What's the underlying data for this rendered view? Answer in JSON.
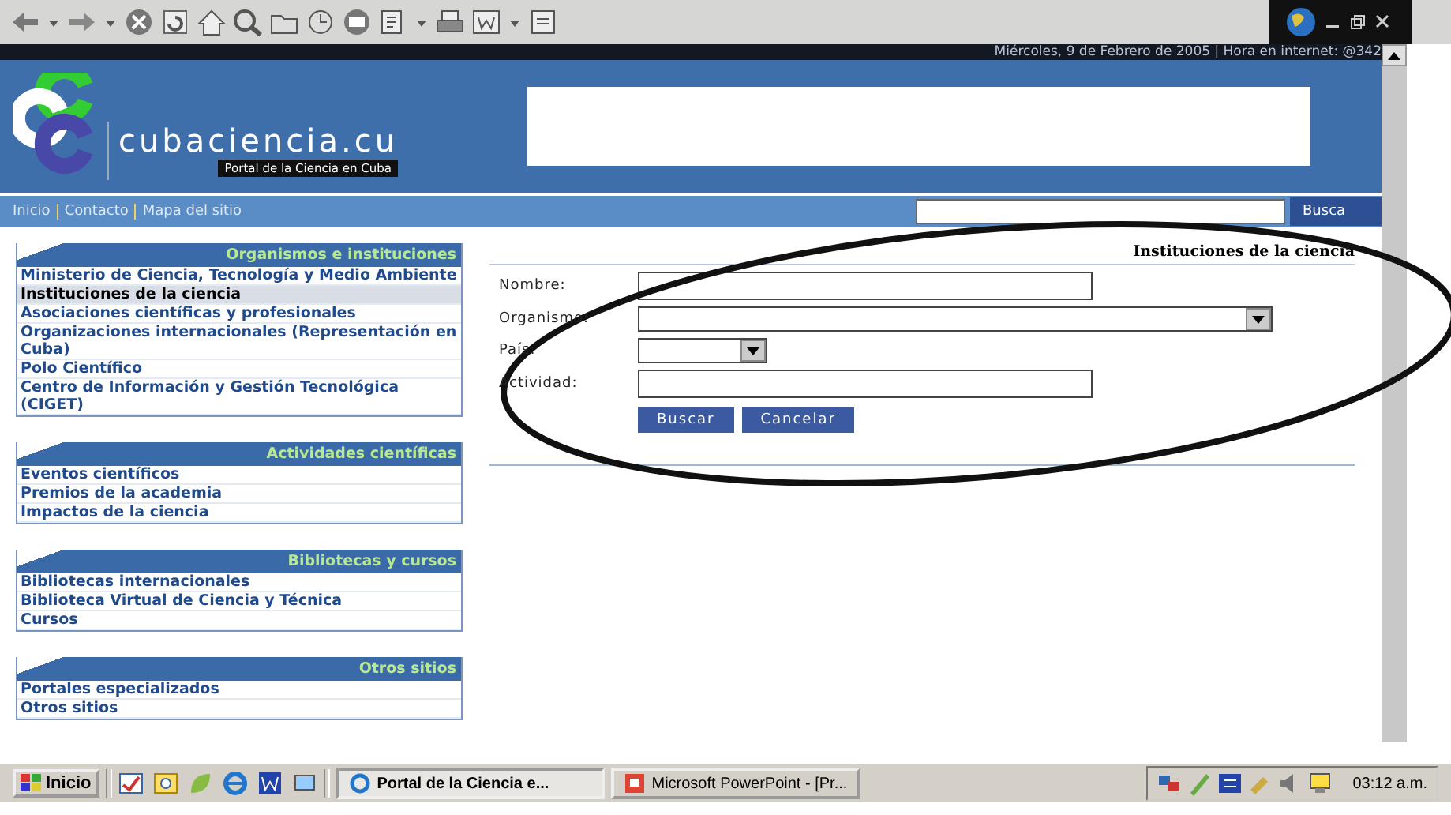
{
  "header": {
    "date_line": "Miércoles, 9 de Febrero de 2005 | Hora en internet: @342",
    "logo_text": "cubaciencia.cu",
    "logo_tagline": "Portal de la Ciencia en Cuba"
  },
  "nav": {
    "links": [
      "Inicio",
      "Contacto",
      "Mapa del sitio"
    ],
    "search_button": "Busca"
  },
  "sidebar": [
    {
      "title": "Organismos e instituciones",
      "items": [
        {
          "label": "Ministerio de Ciencia, Tecnología y Medio Ambiente",
          "selected": false
        },
        {
          "label": "Instituciones de la ciencia",
          "selected": true
        },
        {
          "label": "Asociaciones científicas y profesionales",
          "selected": false
        },
        {
          "label": "Organizaciones internacionales (Representación en Cuba)",
          "selected": false
        },
        {
          "label": "Polo Científico",
          "selected": false
        },
        {
          "label": "Centro de Información y Gestión Tecnológica (CIGET)",
          "selected": false
        }
      ]
    },
    {
      "title": "Actividades científicas",
      "items": [
        {
          "label": "Eventos científicos",
          "selected": false
        },
        {
          "label": "Premios de la academia",
          "selected": false
        },
        {
          "label": "Impactos de la ciencia",
          "selected": false
        }
      ]
    },
    {
      "title": "Bibliotecas y cursos",
      "items": [
        {
          "label": "Bibliotecas internacionales",
          "selected": false
        },
        {
          "label": "Biblioteca Virtual de Ciencia y Técnica",
          "selected": false
        },
        {
          "label": "Cursos",
          "selected": false
        }
      ]
    },
    {
      "title": "Otros sitios",
      "items": [
        {
          "label": "Portales especializados",
          "selected": false
        },
        {
          "label": "Otros sitios",
          "selected": false
        }
      ]
    }
  ],
  "form": {
    "title": "Instituciones de la ciencia",
    "fields": [
      {
        "label": "Nombre:",
        "kind": "text"
      },
      {
        "label": "Organismo:",
        "kind": "dropdown"
      },
      {
        "label": "País:",
        "kind": "shortdropdown"
      },
      {
        "label": "Actividad:",
        "kind": "text"
      }
    ],
    "buttons": [
      "Buscar",
      "Cancelar"
    ]
  },
  "taskbar": {
    "start": "Inicio",
    "tasks": [
      {
        "label": "Portal de la Ciencia e...",
        "selected": true
      },
      {
        "label": "Microsoft PowerPoint - [Pr...",
        "selected": false
      }
    ],
    "clock": "03:12 a.m."
  }
}
